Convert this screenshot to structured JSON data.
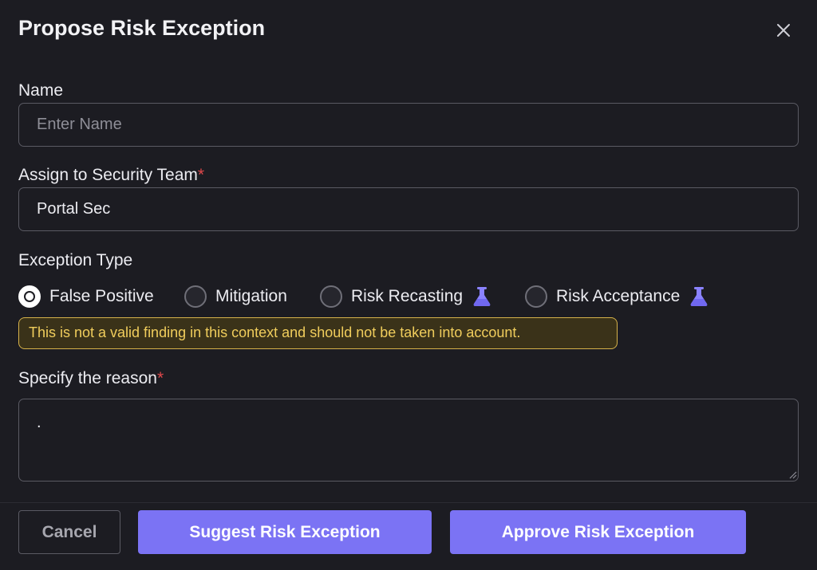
{
  "dialog": {
    "title": "Propose Risk Exception"
  },
  "name_field": {
    "label": "Name",
    "placeholder": "Enter Name",
    "value": ""
  },
  "team_field": {
    "label": "Assign to Security Team",
    "required_mark": "*",
    "value": "Portal Sec"
  },
  "exception_type": {
    "label": "Exception Type",
    "options": [
      {
        "label": "False Positive",
        "selected": true,
        "beta_icon": false
      },
      {
        "label": "Mitigation",
        "selected": false,
        "beta_icon": false
      },
      {
        "label": "Risk Recasting",
        "selected": false,
        "beta_icon": true
      },
      {
        "label": "Risk Acceptance",
        "selected": false,
        "beta_icon": true
      }
    ],
    "hint": "This is not a valid finding in this context and should not be taken into account."
  },
  "reason_field": {
    "label": "Specify the reason",
    "required_mark": "*",
    "value": "."
  },
  "footer": {
    "cancel_label": "Cancel",
    "suggest_label": "Suggest Risk Exception",
    "approve_label": "Approve Risk Exception"
  },
  "colors": {
    "background": "#1c1c22",
    "accent": "#7b73f4",
    "required": "#e0484b",
    "hint_text": "#f0cd5c",
    "hint_border": "#d6b24a"
  },
  "icons": {
    "close": "close-icon",
    "beta": "flask-icon",
    "resize": "resize-grip-icon"
  }
}
